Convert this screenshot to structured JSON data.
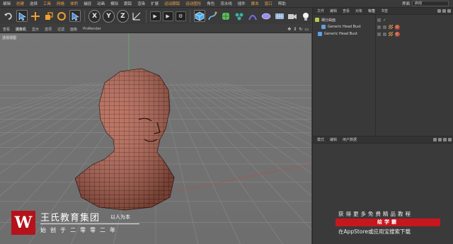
{
  "menubar": {
    "items": [
      "编辑",
      "创建",
      "选择",
      "工具",
      "网格",
      "体积",
      "捕捉",
      "动画",
      "模拟",
      "跟踪",
      "渲染",
      "扩展",
      "运动跟踪",
      "运动图形",
      "角色",
      "流水线",
      "插件",
      "脚本",
      "窗口",
      "帮助"
    ],
    "layout_label": "界面",
    "layout_value": "启动"
  },
  "toolbar": {
    "axis_x": "X",
    "axis_y": "Y",
    "axis_z": "Z"
  },
  "viewport_menu": {
    "items": [
      "查看",
      "摄像机",
      "显示",
      "选项",
      "过滤",
      "面板",
      "ProRender"
    ],
    "active": "摄像机"
  },
  "viewport": {
    "label": "透视视图"
  },
  "object_manager": {
    "tabs": [
      "文件",
      "编辑",
      "查看",
      "对象",
      "标签",
      "书签"
    ],
    "objects": [
      {
        "name": "细分曲面",
        "color": "#b8c84a",
        "check": "✓"
      },
      {
        "name": "Generic Head Bust",
        "color": "#5fa0e0",
        "check": ""
      },
      {
        "name": "Generic Head Bust",
        "color": "#5fa0e0",
        "check": ""
      }
    ]
  },
  "attribute_manager": {
    "tabs": [
      "模式",
      "编辑",
      "用户数据"
    ]
  },
  "watermark": {
    "logo_letter": "W",
    "brand_name": "王氏教育集团",
    "slogan": "以人为本",
    "founded": "始创于二零零二年",
    "promo_line1": "获得更多免费精品教程",
    "promo_button": "绘学霸",
    "promo_line2": "在AppStore或应用宝搜索下载",
    "bottom_text": "王氏教育集团绘学霸"
  },
  "colors": {
    "accent_menu": "#e8a24a",
    "brand_red": "#c8161e",
    "mesh_fill": "#b5624f"
  }
}
